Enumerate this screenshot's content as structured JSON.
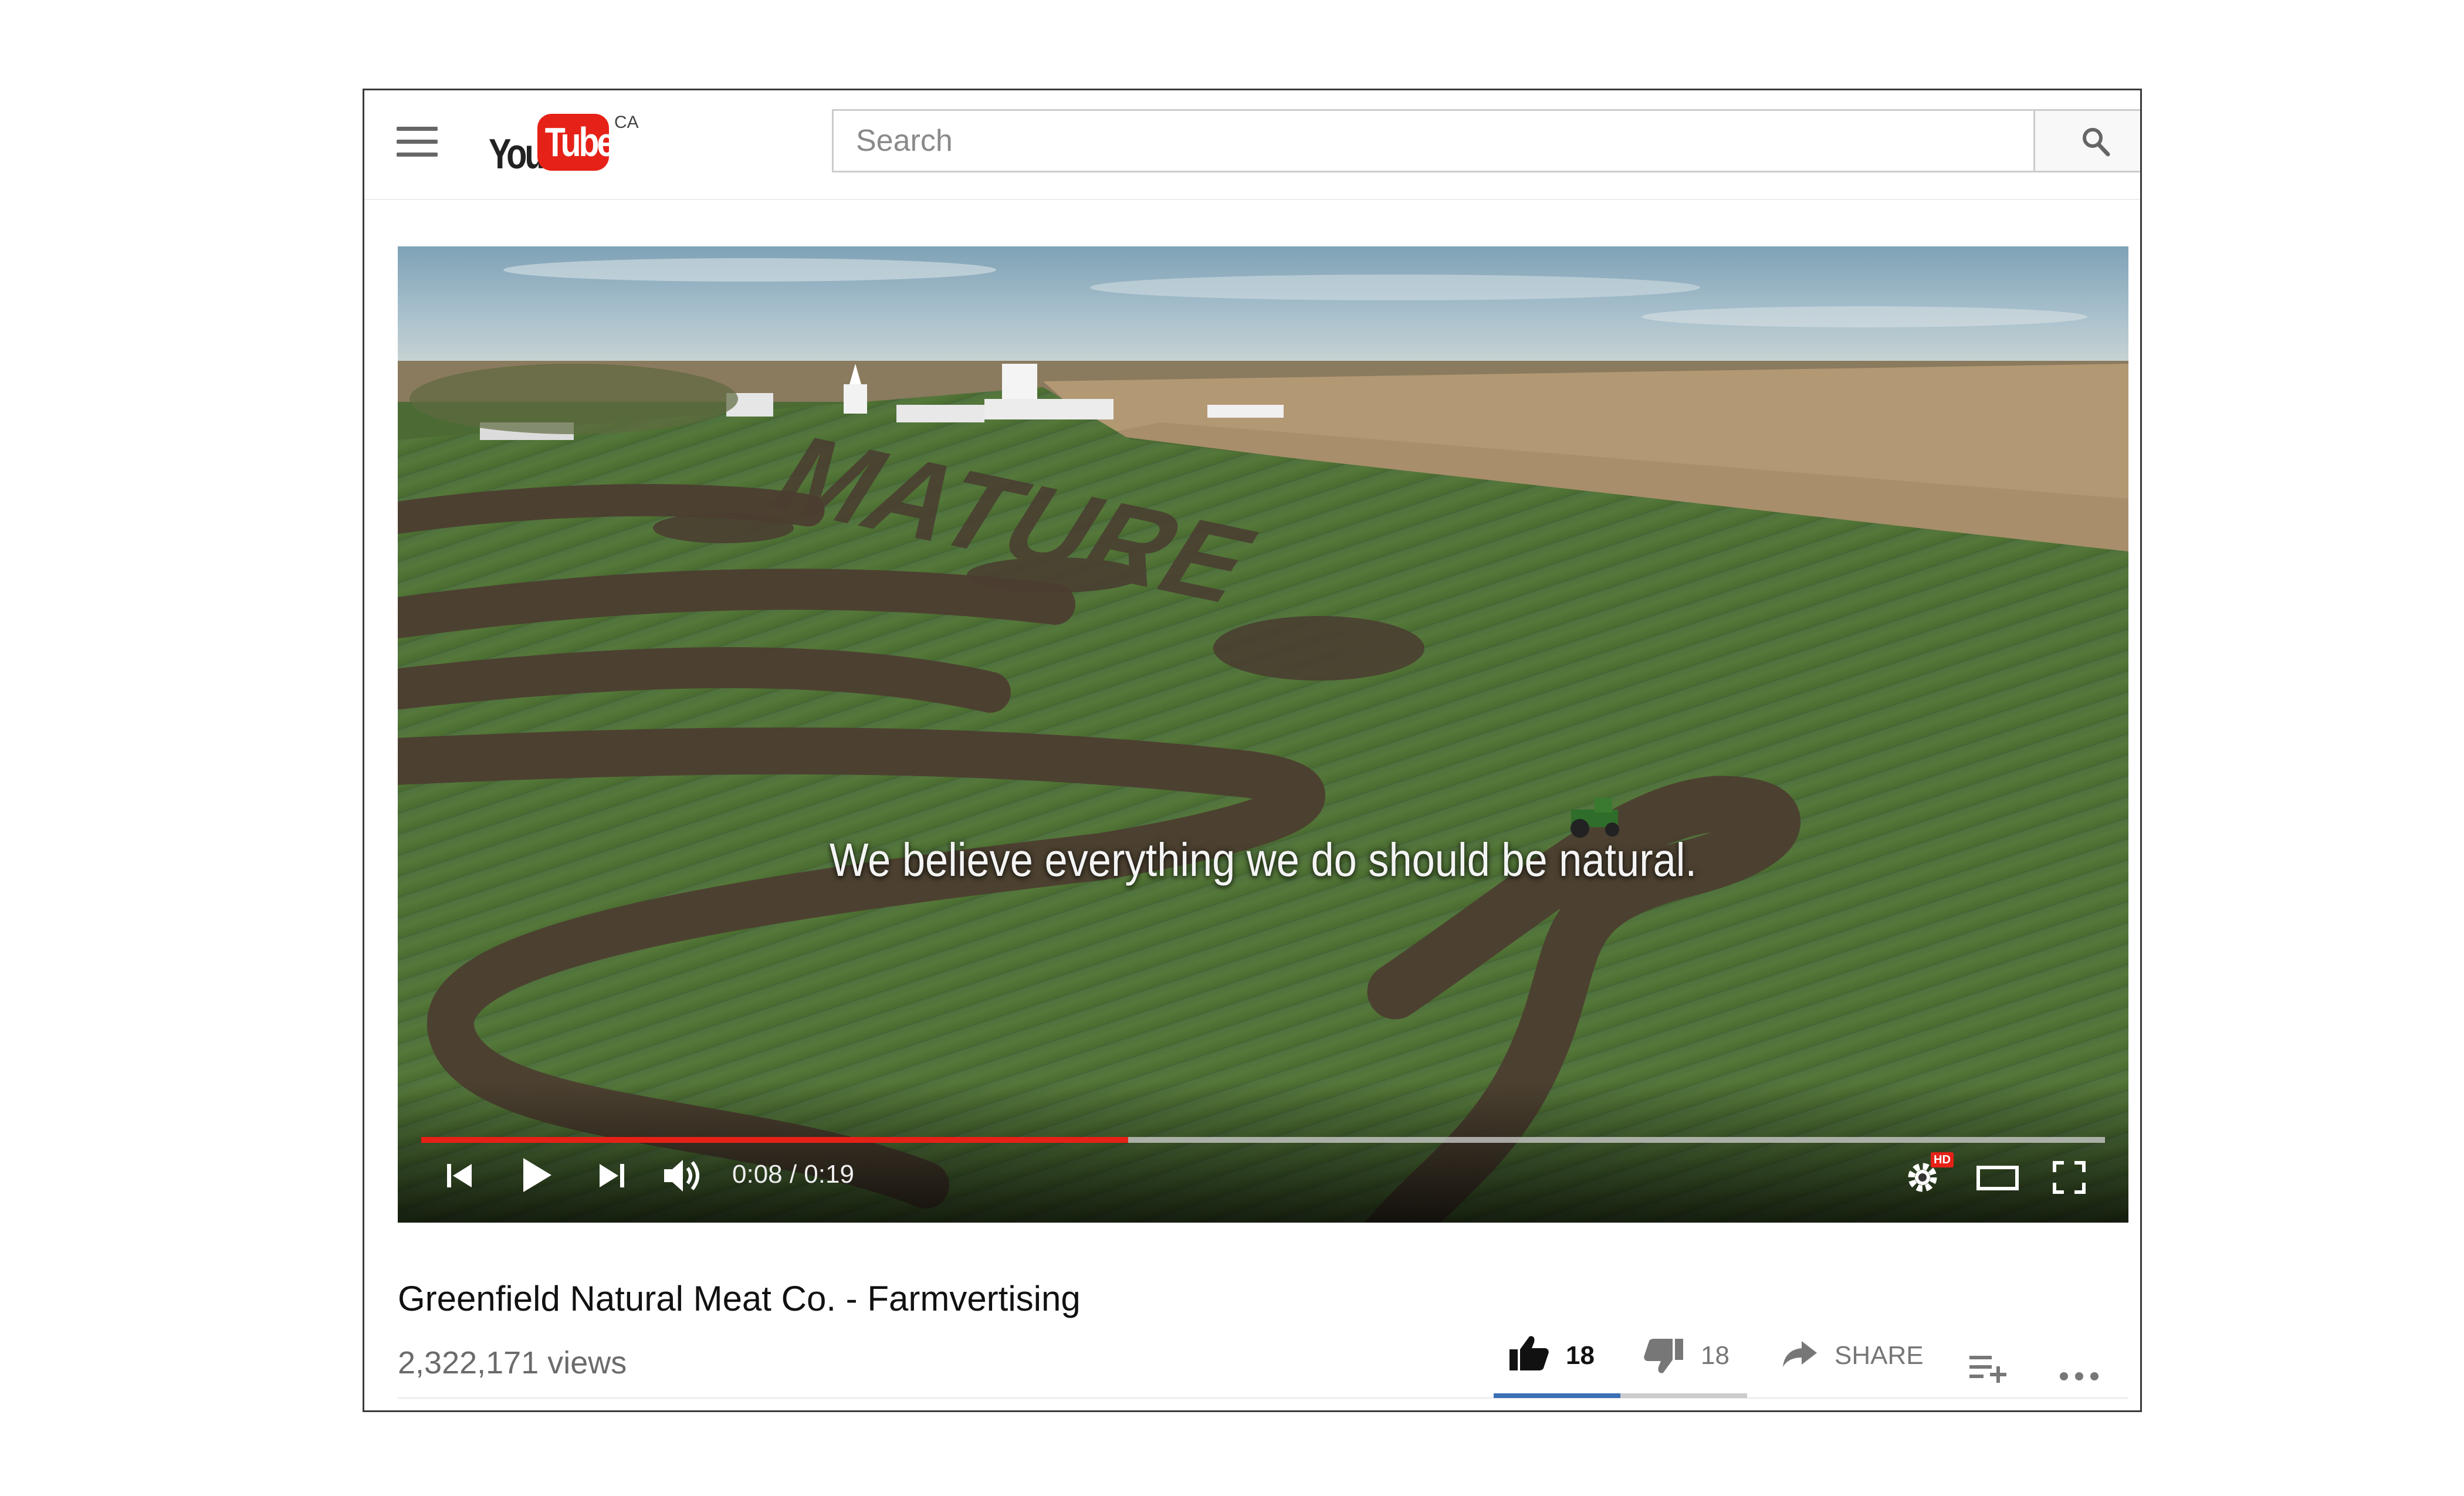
{
  "header": {
    "logo_you": "You",
    "logo_tube": "Tube",
    "region": "CA",
    "search_placeholder": "Search"
  },
  "player": {
    "caption": "We believe everything we do should be natural.",
    "field_text": "MATURE",
    "time_current": "0:08",
    "time_total": "0:19",
    "time_display": "0:08 / 0:19",
    "progress_fraction": 0.42,
    "hd_badge": "HD",
    "icons": [
      "previous-icon",
      "play-icon",
      "next-icon",
      "volume-icon",
      "settings-icon",
      "theater-mode-icon",
      "fullscreen-icon"
    ]
  },
  "video": {
    "title": "Greenfield Natural Meat Co. - Farmvertising",
    "views": "2,322,171 views",
    "likes": "18",
    "dislikes": "18",
    "like_fraction": 0.5,
    "share_label": "SHARE"
  },
  "colors": {
    "brand_red": "#e62117",
    "like_blue": "#3b6fb6",
    "text_dark": "#111111",
    "text_muted": "#6b6b6b"
  }
}
